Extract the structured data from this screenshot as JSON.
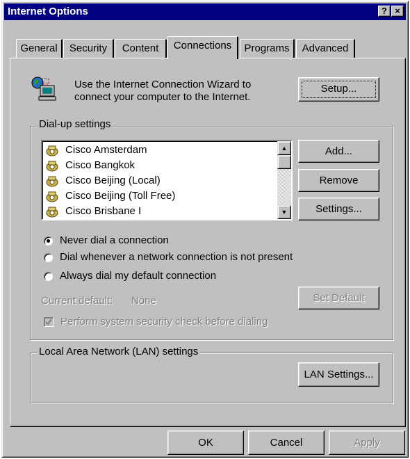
{
  "window": {
    "title": "Internet Options",
    "help_button": "?",
    "close_button": "×"
  },
  "tabs": [
    {
      "label": "General"
    },
    {
      "label": "Security"
    },
    {
      "label": "Content"
    },
    {
      "label": "Connections",
      "active": true
    },
    {
      "label": "Programs"
    },
    {
      "label": "Advanced"
    }
  ],
  "wizard": {
    "text_line1": "Use the Internet Connection Wizard to",
    "text_line2": "connect your computer to the Internet.",
    "setup_button": "Setup..."
  },
  "dialup": {
    "group_label": "Dial-up settings",
    "connections": [
      {
        "label": "Cisco Amsterdam"
      },
      {
        "label": "Cisco Bangkok"
      },
      {
        "label": "Cisco Beijing (Local)"
      },
      {
        "label": "Cisco Beijing (Toll Free)"
      },
      {
        "label": "Cisco Brisbane I"
      }
    ],
    "add_button": "Add...",
    "remove_button": "Remove",
    "settings_button": "Settings...",
    "radio_options": [
      {
        "label": "Never dial a connection",
        "selected": true
      },
      {
        "label": "Dial whenever a network connection is not present",
        "selected": false
      },
      {
        "label": "Always dial my default connection",
        "selected": false
      }
    ],
    "current_default_label": "Current default:",
    "current_default_value": "None",
    "set_default_button": "Set Default",
    "security_check_label": "Perform system security check before dialing",
    "security_check_checked": true
  },
  "lan": {
    "group_label": "Local Area Network (LAN) settings",
    "lan_settings_button": "LAN Settings..."
  },
  "footer": {
    "ok_button": "OK",
    "cancel_button": "Cancel",
    "apply_button": "Apply"
  },
  "colors": {
    "face": "#c0c0c0",
    "titlebar": "#000080",
    "disabled_text": "#808080"
  }
}
